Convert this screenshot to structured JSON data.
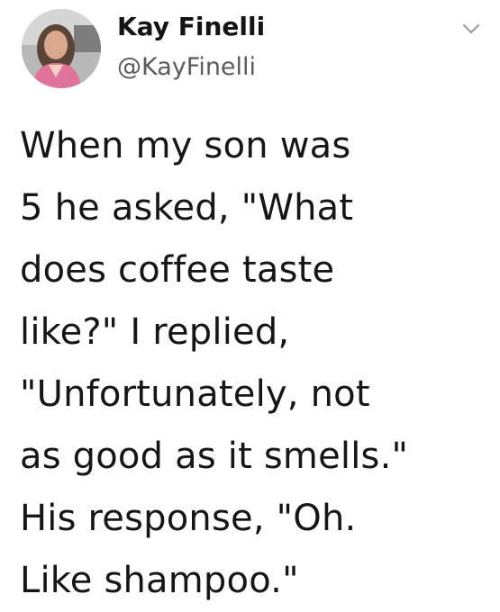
{
  "author": {
    "display_name": "Kay Finelli",
    "handle": "@KayFinelli",
    "avatar_icon": "profile-photo"
  },
  "menu": {
    "icon": "chevron-down-icon"
  },
  "tweet": {
    "lines": [
      "When my son was",
      "5 he asked, \"What",
      "does coffee taste",
      "like?\" I replied,",
      "\"Unfortunately, not",
      "as good as it smells.\"",
      "His response, \"Oh.",
      "Like shampoo.\""
    ]
  },
  "colors": {
    "background": "#ffffff",
    "name_text": "#141414",
    "handle_text": "#5b5b5b",
    "body_text": "#161616"
  }
}
